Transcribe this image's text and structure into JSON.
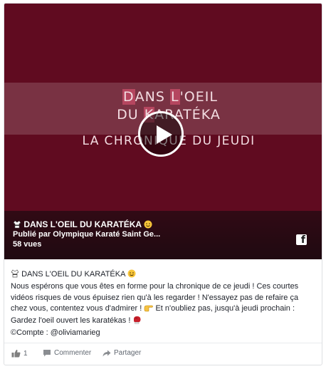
{
  "video": {
    "title_line_1_parts": [
      "D",
      "ANS ",
      "L",
      "'OEIL"
    ],
    "title_line_2_parts": [
      "DU ",
      "K",
      "ARATÉKA"
    ],
    "subtitle": "LA CHRONIQUE DU JEUDI",
    "overlay_title": "DANS L'OEIL DU KARATÉKA",
    "publisher": "Publié par Olympique Karaté Saint Ge...",
    "views": "58 vues",
    "brand_icon": "f"
  },
  "post": {
    "heading": "DANS L'OEIL DU KARATÉKA",
    "lines": [
      "Nous espérons que vous êtes en forme pour la chronique de ce jeudi ! Ces courtes",
      "vidéos risques de vous épuisez rien qu'à les regarder ! N'essayez pas de refaire ça",
      "chez vous, contentez vous d'admirer !",
      "Et n'oubliez pas, jusqu'à jeudi prochain :",
      "Gardez l'oeil ouvert les karatékas !",
      "©Compte : @oliviamarieg"
    ]
  },
  "actions": {
    "like_count": "1",
    "comment_label": "Commenter",
    "share_label": "Partager"
  },
  "colors": {
    "video_bg": "#600b20",
    "highlight": "#b5465f",
    "action_text": "#606770"
  },
  "icons": [
    "karate-uniform-icon",
    "smiling-face-icon",
    "pointing-finger-icon",
    "boxing-glove-icon",
    "facebook-icon",
    "thumbs-up-icon",
    "comment-icon",
    "share-icon",
    "play-icon"
  ]
}
